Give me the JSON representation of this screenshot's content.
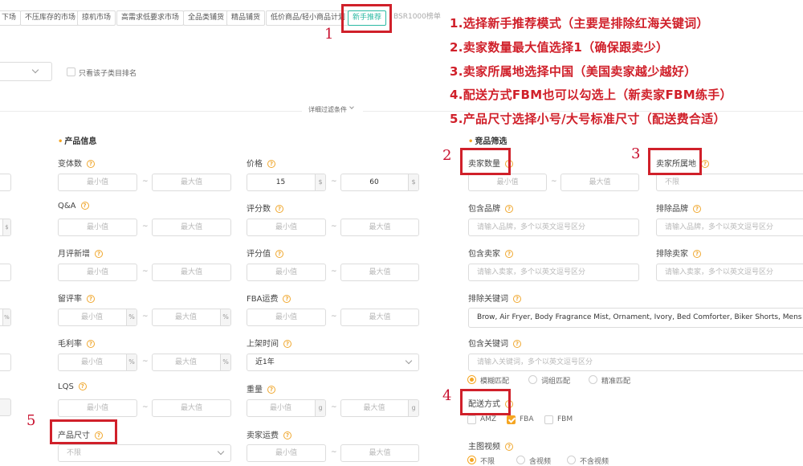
{
  "tags": [
    {
      "label": "下场",
      "active": false
    },
    {
      "label": "不压库存的市场",
      "active": false
    },
    {
      "label": "掠机市场",
      "active": false
    },
    {
      "label": "高需求低要求市场",
      "active": false
    },
    {
      "label": "全品类铺货",
      "active": false
    },
    {
      "label": "精品铺货",
      "active": false
    },
    {
      "label": "低价商品/轻小商品计划",
      "active": false
    },
    {
      "label": "新手推荐",
      "active": true
    },
    {
      "label": "BSR1000榜单",
      "active": false
    }
  ],
  "category_only_label": "只看该子类目排名",
  "detail_filter_label": "详细过滤条件",
  "product_info": {
    "title": "产品信息",
    "variants_label": "变体数",
    "qa_label": "Q&A",
    "monthly_reviews_label": "月评新增",
    "review_rate_label": "留评率",
    "margin_label": "毛利率",
    "lqs_label": "LQS",
    "size_label": "产品尺寸",
    "size_value": "不限",
    "min_placeholder": "最小值",
    "max_placeholder": "最大值",
    "percent": "%"
  },
  "price_col": {
    "price_label": "价格",
    "price_min": "15",
    "price_max": "60",
    "currency": "$",
    "review_count_label": "评分数",
    "rating_label": "评分值",
    "fba_fee_label": "FBA运费",
    "listing_time_label": "上架时间",
    "listing_time_value": "近1年",
    "weight_label": "重量",
    "weight_unit": "g",
    "seller_shipping_label": "卖家运费"
  },
  "product_filter": {
    "title": "竞品筛选",
    "seller_count_label": "卖家数量",
    "seller_location_label": "卖家所属地",
    "seller_location_value": "不限",
    "include_brand_label": "包含品牌",
    "exclude_brand_label": "排除品牌",
    "brand_placeholder": "请输入品牌，多个以英文逗号区分",
    "include_seller_label": "包含卖家",
    "exclude_seller_label": "排除卖家",
    "seller_placeholder": "请输入卖家，多个以英文逗号区分",
    "exclude_keywords_label": "排除关键词",
    "exclude_keywords_value": "Brow, Air Fryer, Body Fragrance Mist, Ornament, Ivory, Bed Comforter, Biker Shorts, Mens Dress Sh",
    "include_keywords_label": "包含关键词",
    "keywords_placeholder": "请输入关键词，多个以英文逗号区分",
    "match_options": [
      "模糊匹配",
      "词组匹配",
      "精准匹配"
    ],
    "delivery_label": "配送方式",
    "delivery_options": [
      {
        "label": "AMZ",
        "checked": false
      },
      {
        "label": "FBA",
        "checked": true
      },
      {
        "label": "FBM",
        "checked": false
      }
    ],
    "main_video_label": "主图视频",
    "video_options": [
      "不限",
      "含视频",
      "不含视频"
    ]
  },
  "annotations": {
    "numbers": [
      "1",
      "2",
      "3",
      "4",
      "5"
    ],
    "notes": [
      "1.选择新手推荐模式（主要是排除红海关键词）",
      "2.卖家数量最大值选择1（确保跟卖少）",
      "3.卖家所属地选择中国（美国卖家越少越好）",
      "4.配送方式FBM也可以勾选上（新卖家FBM练手）",
      "5.产品尺寸选择小号/大号标准尺寸（配送费合适）"
    ],
    "color": "#d0202a"
  },
  "colors": {
    "accent": "#2bb9a3",
    "orange": "#f5a623"
  }
}
